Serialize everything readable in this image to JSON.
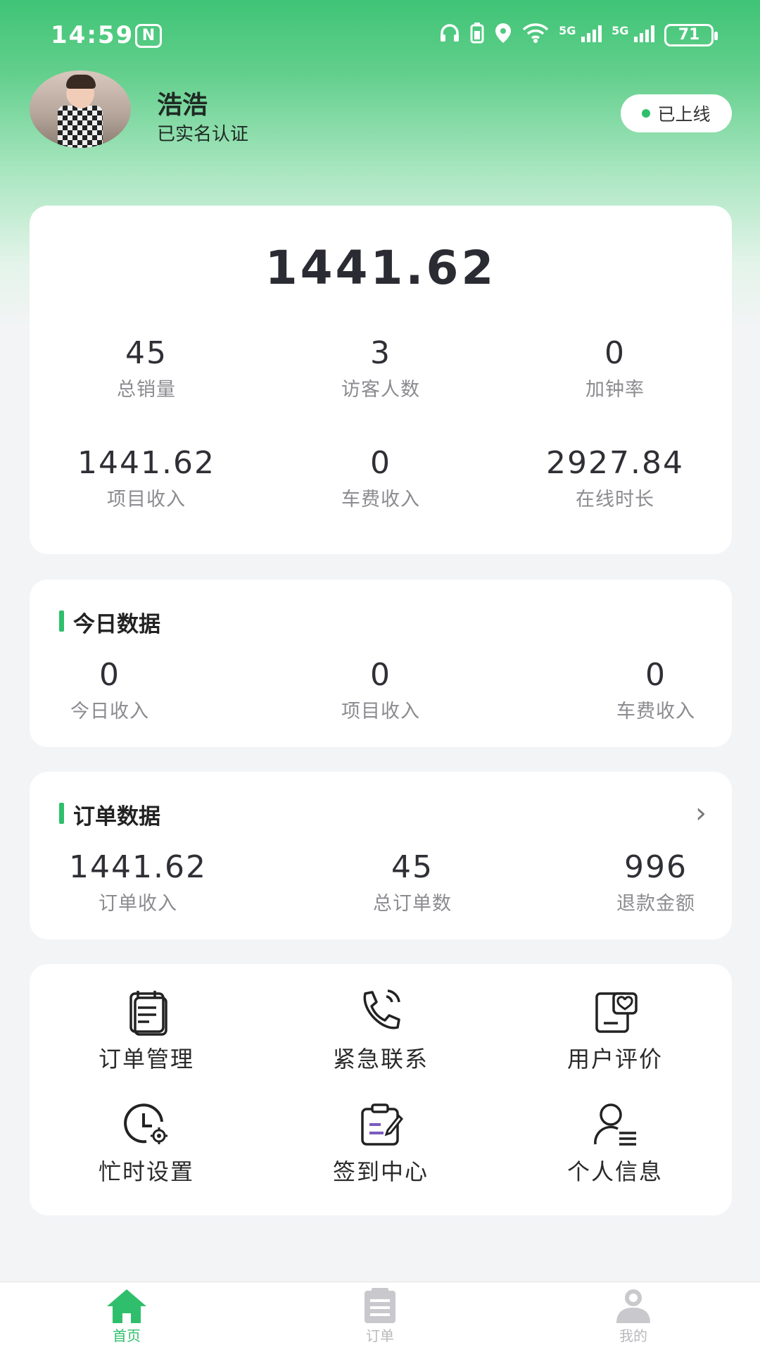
{
  "status_bar": {
    "time": "14:59",
    "nfc_label": "N",
    "network_1": "5G",
    "network_2": "5G",
    "battery": "71"
  },
  "profile": {
    "name": "浩浩",
    "verified": "已实名认证",
    "online_status": "已上线"
  },
  "summary": {
    "amount": "1441.62",
    "stats": [
      {
        "value": "45",
        "label": "总销量"
      },
      {
        "value": "3",
        "label": "访客人数"
      },
      {
        "value": "0",
        "label": "加钟率"
      },
      {
        "value": "1441.62",
        "label": "项目收入"
      },
      {
        "value": "0",
        "label": "车费收入"
      },
      {
        "value": "2927.84",
        "label": "在线时长"
      }
    ]
  },
  "today": {
    "title": "今日数据",
    "stats": [
      {
        "value": "0",
        "label": "今日收入"
      },
      {
        "value": "0",
        "label": "项目收入"
      },
      {
        "value": "0",
        "label": "车费收入"
      }
    ]
  },
  "orders": {
    "title": "订单数据",
    "chevron": "›",
    "stats": [
      {
        "value": "1441.62",
        "label": "订单收入"
      },
      {
        "value": "45",
        "label": "总订单数"
      },
      {
        "value": "996",
        "label": "退款金额"
      }
    ]
  },
  "menu": [
    {
      "label": "订单管理",
      "icon": "order-list-icon"
    },
    {
      "label": "紧急联系",
      "icon": "phone-call-icon"
    },
    {
      "label": "用户评价",
      "icon": "review-icon"
    },
    {
      "label": "忙时设置",
      "icon": "clock-settings-icon"
    },
    {
      "label": "签到中心",
      "icon": "check-in-icon"
    },
    {
      "label": "个人信息",
      "icon": "user-info-icon"
    }
  ],
  "bottom_nav": [
    {
      "label": "首页",
      "icon": "home-icon",
      "active": true
    },
    {
      "label": "订单",
      "icon": "orders-icon",
      "active": false
    },
    {
      "label": "我的",
      "icon": "profile-icon",
      "active": false
    }
  ],
  "colors": {
    "accent": "#2fbf6c",
    "header_gradient_top": "#3fc476",
    "background": "#f3f4f6"
  }
}
